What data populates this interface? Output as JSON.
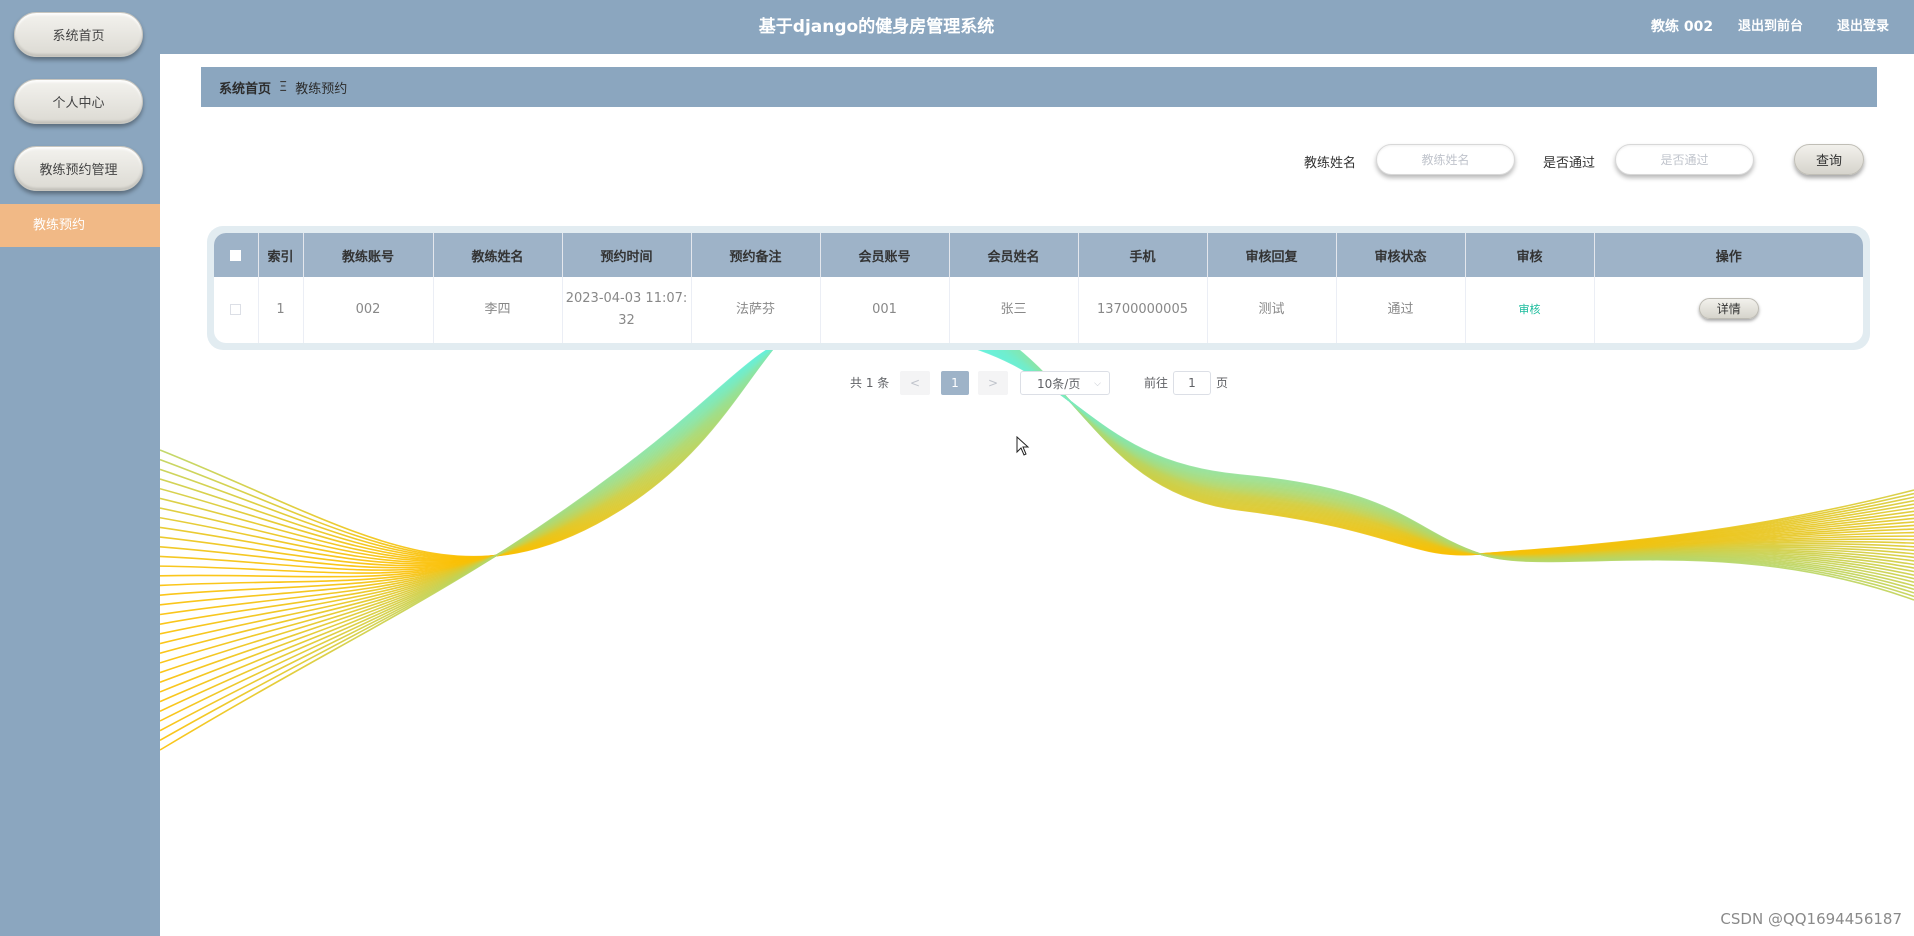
{
  "sidebar": {
    "items": [
      {
        "label": "系统首页"
      },
      {
        "label": "个人中心"
      },
      {
        "label": "教练预约管理"
      }
    ],
    "sub_item": {
      "label": "教练预约"
    }
  },
  "header": {
    "title": "基于django的健身房管理系统",
    "user": "教练 002",
    "links": [
      "退出到前台",
      "退出登录"
    ]
  },
  "breadcrumb": {
    "home": "系统首页",
    "separator": "Ξ",
    "current": "教练预约"
  },
  "search": {
    "fields": [
      {
        "label": "教练姓名",
        "placeholder": "教练姓名"
      },
      {
        "label": "是否通过",
        "placeholder": "是否通过"
      }
    ],
    "button": "查询"
  },
  "table": {
    "columns": [
      "索引",
      "教练账号",
      "教练姓名",
      "预约时间",
      "预约备注",
      "会员账号",
      "会员姓名",
      "手机",
      "审核回复",
      "审核状态",
      "审核",
      "操作"
    ],
    "rows": [
      {
        "index": "1",
        "coach_account": "002",
        "coach_name": "李四",
        "time_line1": "2023-04-03 11:07:",
        "time_line2": "32",
        "note": "法萨芬",
        "member_account": "001",
        "member_name": "张三",
        "phone": "13700000005",
        "reply": "测试",
        "status": "通过",
        "audit_link": "审核",
        "action": "详情"
      }
    ]
  },
  "pagination": {
    "total": "共 1 条",
    "prev": "<",
    "current_page": "1",
    "next": ">",
    "page_size": "10条/页",
    "goto_label": "前往",
    "goto_value": "1",
    "page_suffix": "页"
  },
  "colors": {
    "sidebar_bg": "#8ba6bf",
    "active_item": "#f1b986",
    "table_header": "#9eb3c8",
    "wave_cyan": "#5ff3e6",
    "wave_orange": "#fbbf00"
  },
  "watermark": "CSDN @QQ1694456187"
}
